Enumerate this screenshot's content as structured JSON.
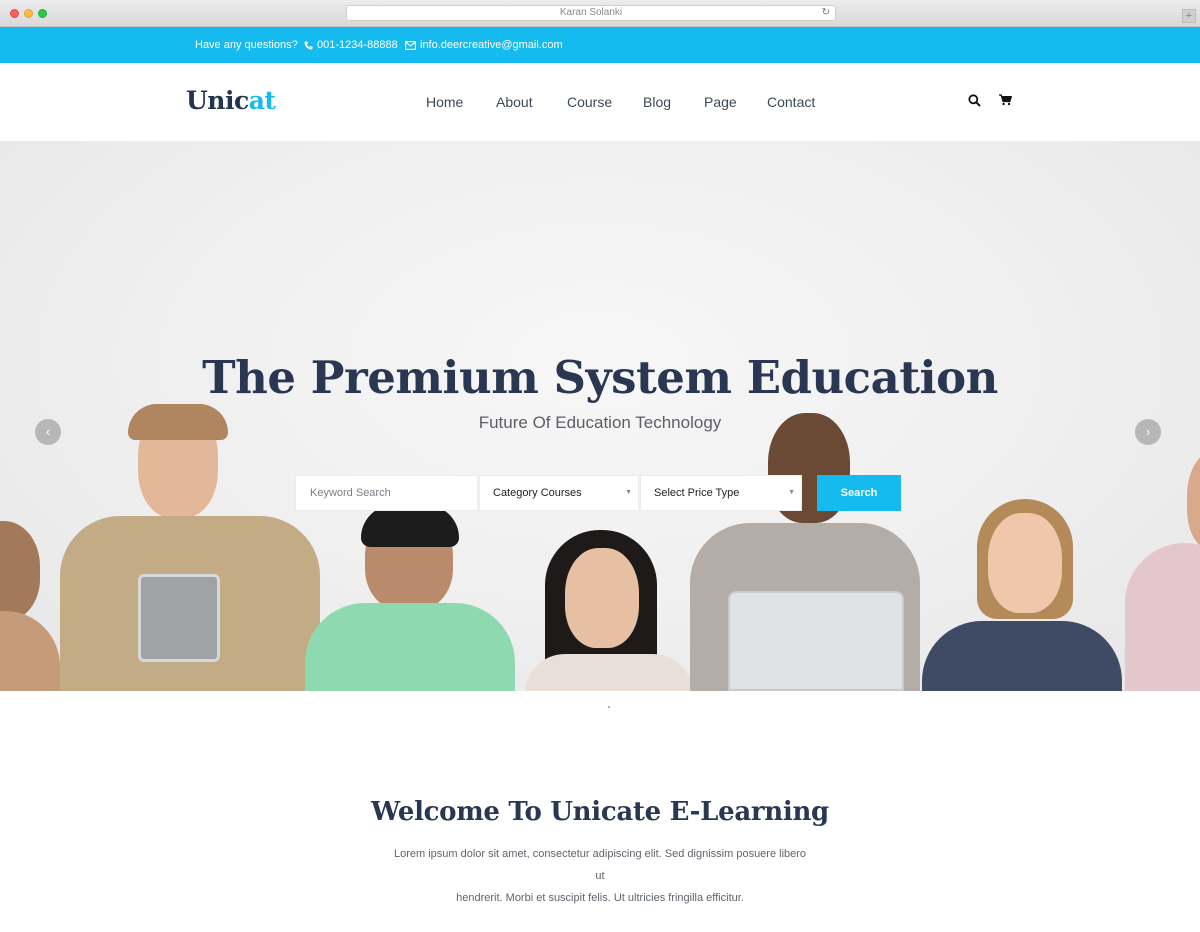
{
  "browser": {
    "url_title": "Karan Solanki"
  },
  "topbar": {
    "question": "Have any questions?",
    "phone": "001-1234-88888",
    "email": "info.deercreative@gmail.com"
  },
  "header": {
    "logo_main": "Unic",
    "logo_accent": "at",
    "nav": [
      "Home",
      "About",
      "Course",
      "Blog",
      "Page",
      "Contact"
    ]
  },
  "hero": {
    "title": "The Premium System Education",
    "subtitle": "Future Of Education Technology",
    "search": {
      "keyword_placeholder": "Keyword Search",
      "category_selected": "Category Courses",
      "price_selected": "Select Price Type",
      "button_label": "Search"
    }
  },
  "welcome": {
    "title": "Welcome To Unicate E-Learning",
    "text_line1": "Lorem ipsum dolor sit amet, consectetur adipiscing elit. Sed dignissim posuere libero ut",
    "text_line2": "hendrerit. Morbi et suscipit felis. Ut ultricies fringilla efficitur."
  },
  "colors": {
    "accent": "#15bbee",
    "heading": "#2a3752",
    "text": "#5e646b"
  },
  "icons": [
    "search-icon",
    "cart-icon",
    "phone-icon",
    "envelope-icon",
    "arrow-left-icon",
    "arrow-right-icon",
    "reload-icon"
  ]
}
